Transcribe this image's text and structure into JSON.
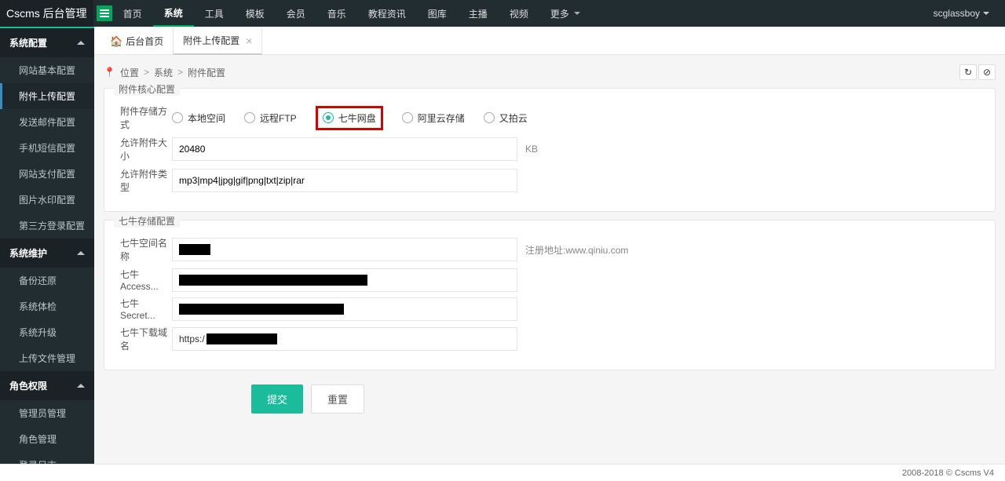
{
  "brand": "Cscms 后台管理",
  "topnav": [
    "首页",
    "系统",
    "工具",
    "模板",
    "会员",
    "音乐",
    "教程资讯",
    "图库",
    "主播",
    "视频",
    "更多"
  ],
  "topnav_active_index": 1,
  "user": "scglassboy",
  "sidebar": {
    "groups": [
      {
        "title": "系统配置",
        "items": [
          "网站基本配置",
          "附件上传配置",
          "发送邮件配置",
          "手机短信配置",
          "网站支付配置",
          "图片水印配置",
          "第三方登录配置"
        ],
        "active_index": 1
      },
      {
        "title": "系统维护",
        "items": [
          "备份还原",
          "系统体检",
          "系统升级",
          "上传文件管理"
        ]
      },
      {
        "title": "角色权限",
        "items": [
          "管理员管理",
          "角色管理",
          "登录日志"
        ]
      }
    ]
  },
  "tabs": {
    "items": [
      {
        "label": "后台首页",
        "icon": "home",
        "closable": false
      },
      {
        "label": "附件上传配置",
        "closable": true
      }
    ],
    "active_index": 1
  },
  "breadcrumb": {
    "prefix": "位置",
    "parts": [
      "系统",
      "附件配置"
    ]
  },
  "form": {
    "core": {
      "legend": "附件核心配置",
      "storage_label": "附件存储方式",
      "storage_options": [
        "本地空间",
        "远程FTP",
        "七牛网盘",
        "阿里云存储",
        "又拍云"
      ],
      "storage_selected_index": 2,
      "size_label": "允许附件大小",
      "size_value": "20480",
      "size_unit": "KB",
      "type_label": "允许附件类型",
      "type_value": "mp3|mp4|jpg|gif|png|txt|zip|rar"
    },
    "qiniu": {
      "legend": "七牛存储配置",
      "space_label": "七牛空间名称",
      "space_hint": "注册地址:www.qiniu.com",
      "access_label": "七牛Access...",
      "secret_label": "七牛Secret...",
      "domain_label": "七牛下载域名",
      "domain_value_prefix": "https:/"
    }
  },
  "buttons": {
    "submit": "提交",
    "reset": "重置"
  },
  "footer": "2008-2018 © Cscms V4"
}
